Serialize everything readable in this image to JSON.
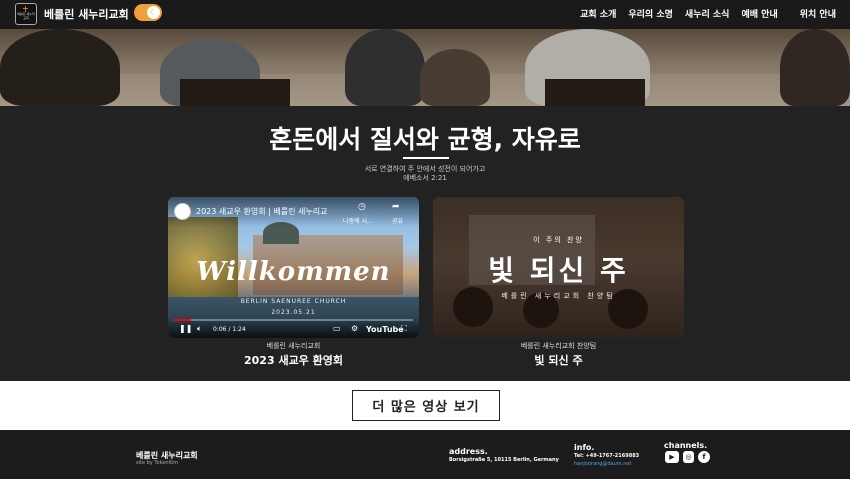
{
  "header": {
    "logo_text": "베를린 새누리 교회",
    "brand": "베를린 새누리교회",
    "toggle_icon": "☾",
    "nav": [
      "교회 소개",
      "우리의 소명",
      "새누리 소식",
      "예배 안내",
      "위치 안내"
    ]
  },
  "hero": {
    "title": "혼돈에서 질서와 균형, 자유로",
    "verse_line1": "서로 연결하여 주 안에서 성전이 되어가고",
    "verse_line2": "에베소서 2:21"
  },
  "videos": [
    {
      "embed_title": "2023 새교우 환영회 | 베를린 새누리교",
      "watch_later": "나중에 시...",
      "share": "공유",
      "overlay_big": "Willkommen",
      "overlay_church": "BERLIN SAENUREE CHURCH",
      "overlay_date": "2023.05.21",
      "time": "0:06 / 1:24",
      "progress": 0.07,
      "youtube_label": "YouTube",
      "caption_sub": "베를린 새누리교회",
      "caption_main": "2023 새교우 환영회"
    },
    {
      "overlay_small": "이 주의 찬양",
      "overlay_big": "빛 되신 주",
      "overlay_team": "베를린 새누리교회 찬양팀",
      "caption_sub": "베를린 새누리교회 찬양팀",
      "caption_main": "빛 되신 주"
    }
  ],
  "more_button": "더 많은 영상 보기",
  "footer": {
    "name": "베를린 새누리교회",
    "site_by": "site by TokenKim",
    "address_h": "address.",
    "address": "Borsigstraße 5, 10115 Berlin, Germany",
    "info_h": "info.",
    "tel": "Tel: +49-1767-2169883",
    "email": "hanjoorang@daum.net",
    "channels_h": "channels."
  },
  "icons": {
    "toggle": "moon-icon",
    "social": [
      "youtube-icon",
      "instagram-icon",
      "facebook-icon"
    ]
  },
  "colors": {
    "toggle": "#f0a03a",
    "dark_bg": "#222222",
    "progress": "#ff0000"
  }
}
